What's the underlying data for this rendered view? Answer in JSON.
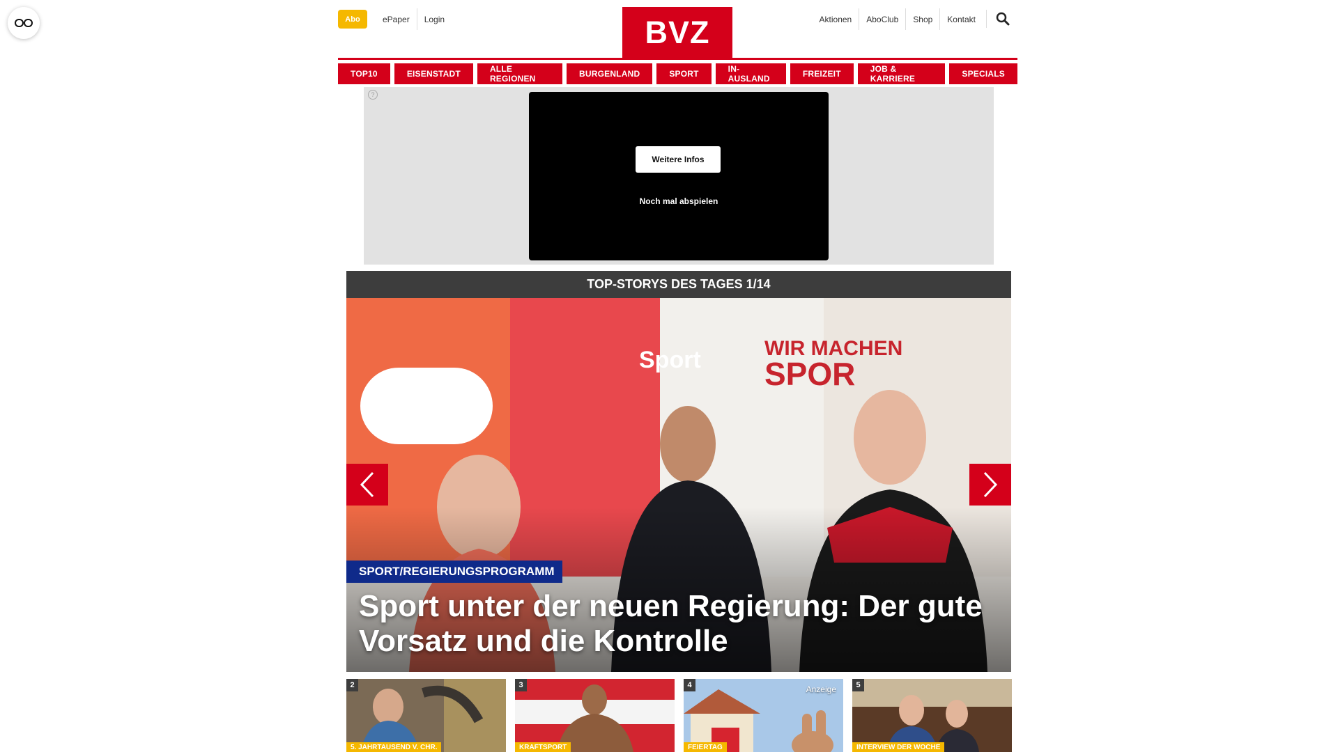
{
  "header": {
    "abo_label": "Abo",
    "left_links": [
      "ePaper",
      "Login"
    ],
    "logo_text": "BVZ",
    "right_links": [
      "Aktionen",
      "AboClub",
      "Shop",
      "Kontakt"
    ]
  },
  "nav": {
    "items": [
      "TOP10",
      "EISENSTADT",
      "ALLE REGIONEN",
      "BURGENLAND",
      "SPORT",
      "IN-AUSLAND",
      "FREIZEIT",
      "JOB & KARRIERE",
      "SPECIALS"
    ]
  },
  "ad": {
    "info_symbol": "?",
    "more_info_label": "Weitere Infos",
    "replay_label": "Noch mal abspielen"
  },
  "stories": {
    "bar_title": "TOP-STORYS DES TAGES 1/14",
    "hero": {
      "kicker": "SPORT/REGIERUNGSPROGRAMM",
      "headline": "Sport unter der neuen Regierung: Der gute Vorsatz und die Kontrolle"
    },
    "thumbnails": [
      {
        "num": "2",
        "tag": "5. JAHRTAUSEND V. CHR.",
        "ad_label": ""
      },
      {
        "num": "3",
        "tag": "KRAFTSPORT",
        "ad_label": ""
      },
      {
        "num": "4",
        "tag": "FEIERTAG",
        "ad_label": "Anzeige"
      },
      {
        "num": "5",
        "tag": "INTERVIEW DER WOCHE",
        "ad_label": ""
      }
    ]
  },
  "colors": {
    "brand_red": "#d4001a",
    "abo_yellow": "#f5b800",
    "kicker_blue": "#0f2a8a",
    "bar_gray": "#3d3d3d"
  }
}
